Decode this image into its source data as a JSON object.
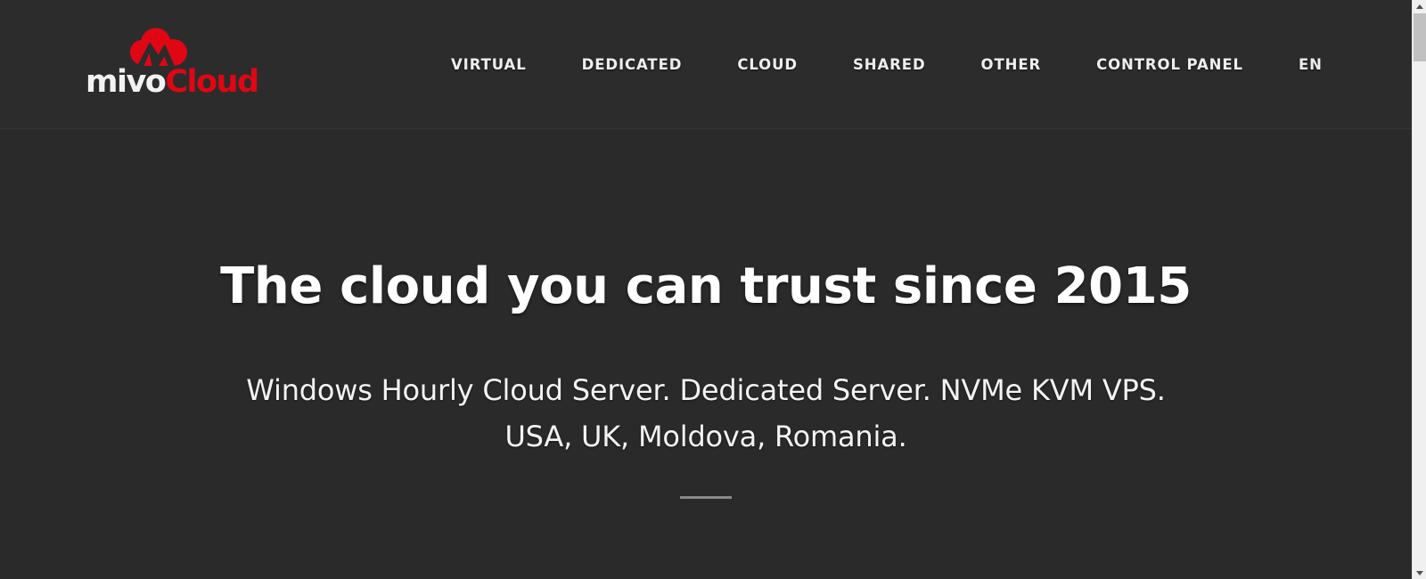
{
  "theme": {
    "background": "#2a2a2a",
    "header_background": "#2c2c2c",
    "accent_red": "#e00613",
    "text_primary": "#ffffff",
    "divider": "#8a8a8a"
  },
  "header": {
    "brand": {
      "name_part1": "mivo",
      "name_part2": "Cloud",
      "mark": "cloud-m-logo"
    },
    "nav": [
      {
        "label": "VIRTUAL"
      },
      {
        "label": "DEDICATED"
      },
      {
        "label": "CLOUD"
      },
      {
        "label": "SHARED"
      },
      {
        "label": "OTHER"
      },
      {
        "label": "CONTROL PANEL"
      },
      {
        "label": "EN"
      }
    ]
  },
  "hero": {
    "title": "The cloud you can trust since 2015",
    "subtitle_line1": "Windows Hourly Cloud Server. Dedicated Server. NVMe KVM VPS.",
    "subtitle_line2": "USA, UK, Moldova, Romania."
  },
  "scrollbar": {
    "up_arrow": "scroll-up-arrow",
    "down_arrow": "scroll-down-arrow",
    "thumb": "scroll-thumb"
  }
}
